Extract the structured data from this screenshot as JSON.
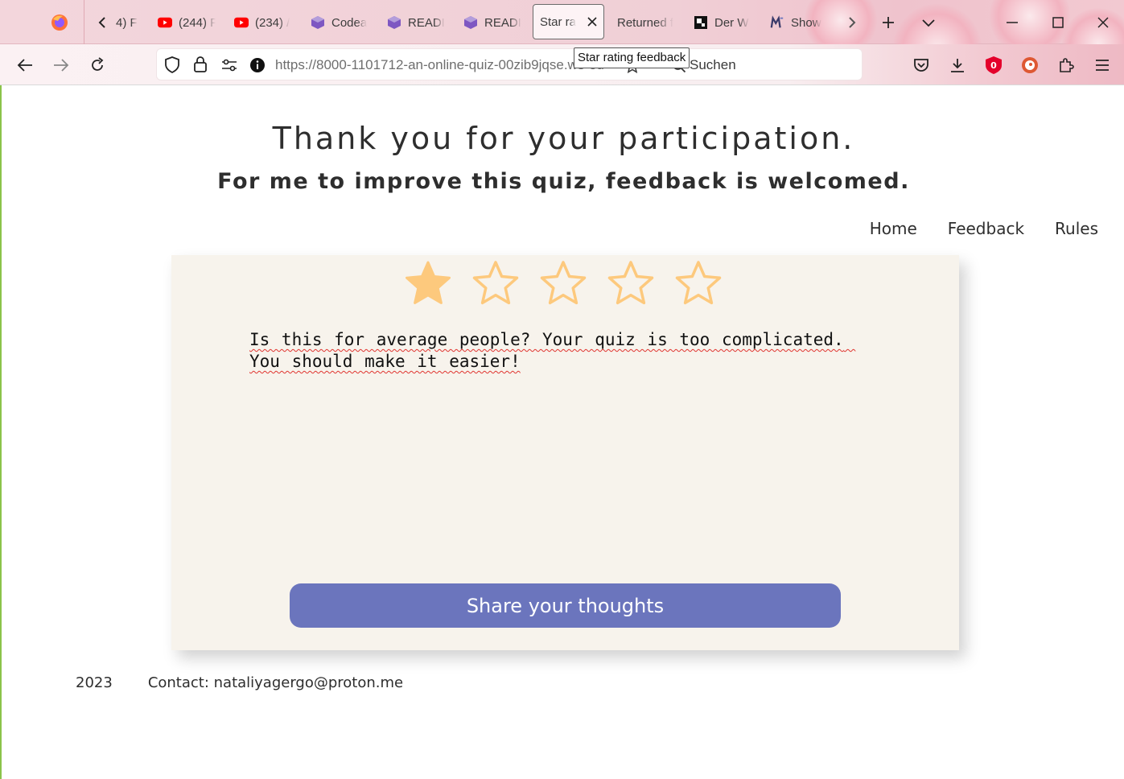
{
  "browser": {
    "tabs": [
      {
        "label": "4) F",
        "icon": "chevron-left-icon"
      },
      {
        "label": "(244) F",
        "icon": "youtube-icon"
      },
      {
        "label": "(234) /",
        "icon": "youtube-icon"
      },
      {
        "label": "Codea",
        "icon": "cube-icon"
      },
      {
        "label": "READI",
        "icon": "cube-icon"
      },
      {
        "label": "READI",
        "icon": "cube-icon"
      },
      {
        "label": "Star ra",
        "icon": "",
        "active": true
      },
      {
        "label": "Returned f",
        "icon": ""
      },
      {
        "label": "Der W",
        "icon": "doc-icon"
      },
      {
        "label": "Show",
        "icon": "mu-icon"
      }
    ],
    "url": "https://8000-1101712-an-online-quiz-00zib9jqse.ws-eu",
    "search_placeholder": "Suchen",
    "tooltip": "Star rating feedback"
  },
  "page": {
    "title": "Thank you for your participation.",
    "subtitle": "For me to improve this quiz, feedback is welcomed.",
    "nav": {
      "home": "Home",
      "feedback": "Feedback",
      "rules": "Rules"
    },
    "rating": {
      "max": 5,
      "value": 1,
      "filled_color": "#fdc97d",
      "empty_color": "#fdc97d"
    },
    "feedback_text": "Is this for average people? Your quiz is too complicated. You should make it easier!",
    "submit_label": "Share your thoughts",
    "accent_color": "#6b75bd",
    "footer": {
      "year": "2023",
      "contact": "Contact: nataliyagergo@proton.me"
    }
  }
}
